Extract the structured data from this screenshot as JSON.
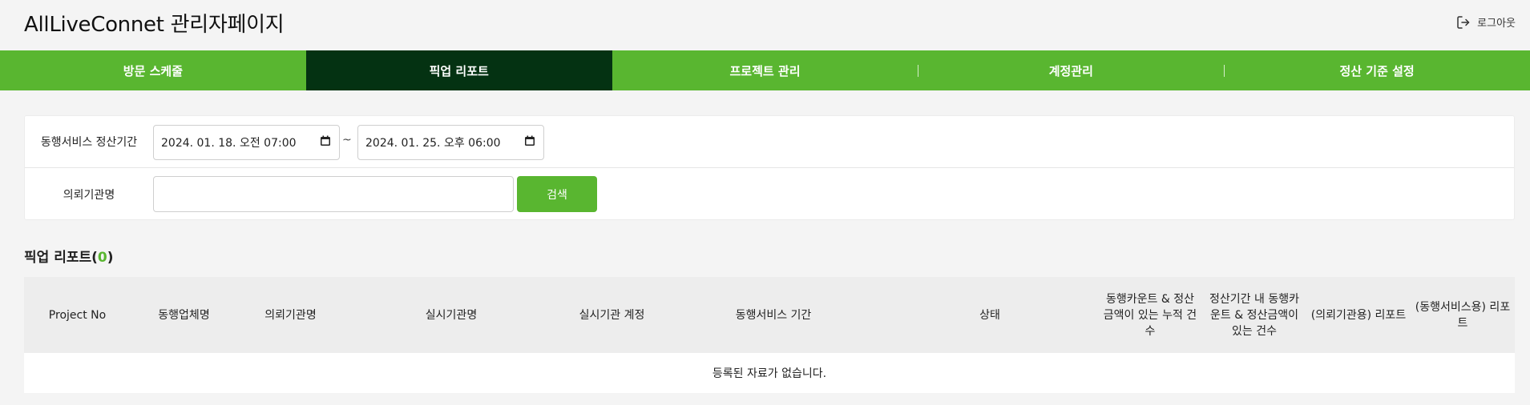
{
  "header": {
    "title": "AllLiveConnet 관리자페이지",
    "logout_label": "로그아웃"
  },
  "nav": {
    "items": [
      {
        "label": "방문 스케줄"
      },
      {
        "label": "픽업 리포트",
        "active": true
      },
      {
        "label": "프로젝트 관리"
      },
      {
        "label": "계정관리"
      },
      {
        "label": "정산 기준 설정"
      }
    ]
  },
  "filters": {
    "period_label": "동행서비스 정산기간",
    "start_date": "2024. 01. 18. 오전 07:00",
    "end_date": "2024. 01. 25. 오후 06:00",
    "separator": "~",
    "org_label": "의뢰기관명",
    "org_value": "",
    "org_placeholder": "",
    "search_label": "검색"
  },
  "report": {
    "title": "픽업 리포트",
    "count": "0"
  },
  "table": {
    "columns": [
      "Project No",
      "동행업체명",
      "의뢰기관명",
      "실시기관명",
      "실시기관 계정",
      "동행서비스 기간",
      "상태",
      "동행카운트 & 정산금액이 있는 누적 건수",
      "정산기간 내 동행카운트 & 정산금액이 있는 건수",
      "(의뢰기관용) 리포트",
      "(동행서비스용) 리포트"
    ],
    "empty_message": "등록된 자료가 없습니다."
  },
  "colors": {
    "accent": "#59b630",
    "nav_active": "#043212",
    "background": "#f4f4f4"
  }
}
